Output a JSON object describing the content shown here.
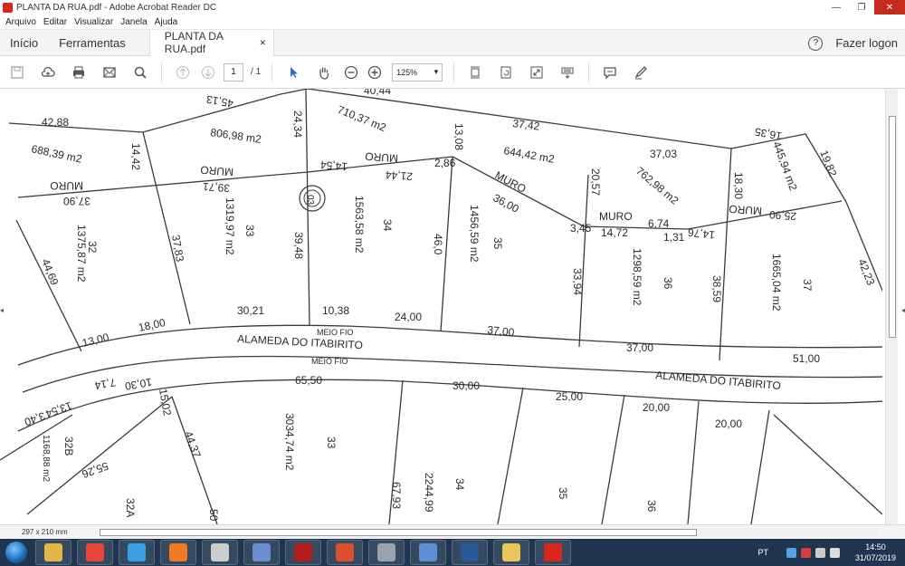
{
  "window": {
    "title": "PLANTA DA RUA.pdf - Adobe Acrobat Reader DC",
    "minimize_icon": "minimize-icon",
    "maximize_icon": "restore-icon",
    "close_icon": "close-icon"
  },
  "menu": [
    "Arquivo",
    "Editar",
    "Visualizar",
    "Janela",
    "Ajuda"
  ],
  "tabs": {
    "home": "Início",
    "tools": "Ferramentas",
    "document": "PLANTA DA RUA.pdf",
    "close_glyph": "×",
    "help_glyph": "?",
    "login": "Fazer logon"
  },
  "toolbar": {
    "page_current": "1",
    "page_total": "/ 1",
    "zoom": "125%",
    "zoom_arrow": "▾"
  },
  "status": {
    "page_size": "297 x 210 mm"
  },
  "document": {
    "labels": {
      "t1": "42,88",
      "t2": "688,39 m2",
      "t3": "MURO",
      "t4": "37,90",
      "t5": "14,42",
      "t6": "806,98 m2",
      "t7": "MURO",
      "t8": "39,71",
      "t9": "45,13",
      "t10": "24,34",
      "t11": "710,37 m2",
      "t12": "MURO",
      "t13": "14,54",
      "t14": "21,44",
      "t15": "40,44",
      "t16": "13,08",
      "t17": "2,86",
      "t18": "37,42",
      "t19": "644,42 m2",
      "t20": "MURO",
      "t21": "36,00",
      "t22": "37,03",
      "t23": "762,98 m2",
      "t24": "20,57",
      "t25": "MURO",
      "t26": "6,74",
      "t27": "3,45",
      "t28": "14,72",
      "t29": "1,31",
      "t30": "14,76",
      "t31": "18,30",
      "t32": "MURO",
      "t33": "16,35",
      "t34": "445,94 m2",
      "t35": "19,82",
      "t36": "25,90",
      "t37": "32",
      "t38": "1375,87 m2",
      "t39": "44,69",
      "t40": "33",
      "t41": "1319,97 m2",
      "t42": "37,83",
      "t43": "30,21",
      "t44": "03",
      "t45": "1563,58 m2",
      "t46": "34",
      "t47": "39,48",
      "t48": "10,38",
      "t49": "24,00",
      "t50": "46,0",
      "t51": "1456,59 m2",
      "t52": "35",
      "t53": "37,00",
      "t54": "33,94",
      "t55": "1298,59 m2",
      "t56": "36",
      "t57": "38,59",
      "t58": "1665,04 m2",
      "t59": "37",
      "t60": "42,23",
      "t61": "18,00",
      "t62": "13,00",
      "t63": "MEIO FIO",
      "t64": "ALAMEDA DO ITABIRITO",
      "t65": "37,00",
      "t66": "51,00",
      "t67": "MEIO FIO",
      "t68": "ALAMEDA DO ITABIRITO",
      "t69": "65,50",
      "t70": "30,00",
      "t71": "25,00",
      "t72": "20,00",
      "t73": "20,00",
      "t74": "7,14",
      "t75": "10,30",
      "t76": "15,02",
      "t77": "13,54",
      "t78": "3,40",
      "t79": "1168,88 m2",
      "t80": "32B",
      "t81": "44,37",
      "t82": "55,26",
      "t83": "32A",
      "t84": "3034,74 m2",
      "t85": "33",
      "t86": "67,93",
      "t87": "2244,99",
      "t88": "34",
      "t89": "35",
      "t90": "36",
      "t91": "50"
    }
  },
  "taskbar": {
    "apps": [
      {
        "icon": "explorer-icon",
        "color": "#e6b54a"
      },
      {
        "icon": "chrome-icon",
        "color": "#e9463a"
      },
      {
        "icon": "internet-explorer-icon",
        "color": "#3aa0e6"
      },
      {
        "icon": "firefox-icon",
        "color": "#f07a22"
      },
      {
        "icon": "app-icon",
        "color": "#cccccc"
      },
      {
        "icon": "contacts-icon",
        "color": "#6a8fd0"
      },
      {
        "icon": "record-icon",
        "color": "#b11d1d"
      },
      {
        "icon": "calculator-icon",
        "color": "#d9502f"
      },
      {
        "icon": "disk-icon",
        "color": "#9aa3ad"
      },
      {
        "icon": "network-icon",
        "color": "#5a8fd8"
      },
      {
        "icon": "word-icon",
        "color": "#2b5797"
      },
      {
        "icon": "folder-icon",
        "color": "#e8c65a"
      },
      {
        "icon": "acrobat-icon",
        "color": "#d9261c"
      }
    ],
    "language": "PT",
    "time": "14:50",
    "date": "31/07/2019"
  }
}
